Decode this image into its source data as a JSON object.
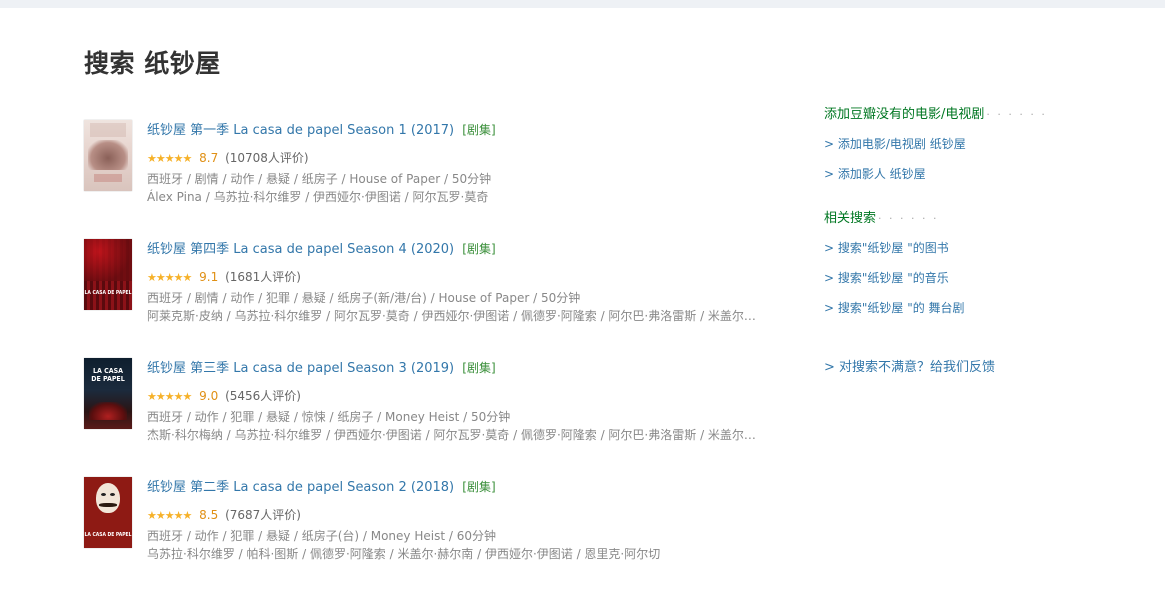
{
  "page": {
    "title": "搜索 纸钞屋"
  },
  "results": [
    {
      "title": "纸钞屋 第一季 La casa de papel Season 1 (2017)",
      "tag": "[剧集]",
      "stars": "★★★★★",
      "score": "8.7",
      "votes": "(10708人评价)",
      "meta": "西班牙 / 剧情 / 动作 / 悬疑 / 纸房子 / House of Paper / 50分钟",
      "cast": "Álex Pina / 乌苏拉·科尔维罗 / 伊西娅尔·伊图诺 / 阿尔瓦罗·莫奇",
      "poster_text": "LA CASA DE PAPEL"
    },
    {
      "title": "纸钞屋 第四季 La casa de papel Season 4 (2020)",
      "tag": "[剧集]",
      "stars": "★★★★★",
      "score": "9.1",
      "votes": "(1681人评价)",
      "meta": "西班牙 / 剧情 / 动作 / 犯罪 / 悬疑 / 纸房子(新/港/台) / House of Paper / 50分钟",
      "cast": "阿莱克斯·皮纳 / 乌苏拉·科尔维罗 / 阿尔瓦罗·莫奇 / 伊西娅尔·伊图诺 / 佩德罗·阿隆索 / 阿尔巴·弗洛雷斯 / 米盖尔·...",
      "poster_text": "LA CASA DE PAPEL"
    },
    {
      "title": "纸钞屋 第三季 La casa de papel Season 3 (2019)",
      "tag": "[剧集]",
      "stars": "★★★★★",
      "score": "9.0",
      "votes": "(5456人评价)",
      "meta": "西班牙 / 动作 / 犯罪 / 悬疑 / 惊悚 / 纸房子 / Money Heist / 50分钟",
      "cast": "杰斯·科尔梅纳 / 乌苏拉·科尔维罗 / 伊西娅尔·伊图诺 / 阿尔瓦罗·莫奇 / 佩德罗·阿隆索 / 阿尔巴·弗洛雷斯 / 米盖尔·...",
      "poster_text": "LA CASA DE PAPEL"
    },
    {
      "title": "纸钞屋 第二季 La casa de papel Season 2 (2018)",
      "tag": "[剧集]",
      "stars": "★★★★★",
      "score": "8.5",
      "votes": "(7687人评价)",
      "meta": "西班牙 / 动作 / 犯罪 / 悬疑 / 纸房子(台) / Money Heist / 60分钟",
      "cast": "乌苏拉·科尔维罗 / 帕科·图斯 / 佩德罗·阿隆索 / 米盖尔·赫尔南 / 伊西娅尔·伊图诺 / 恩里克·阿尔切",
      "poster_text": "LA CASA DE PAPEL"
    }
  ],
  "aside": {
    "add_heading": "添加豆瓣没有的电影/电视剧",
    "dots": "· · · · · ·",
    "add_movie": "> 添加电影/电视剧 纸钞屋",
    "add_person": "> 添加影人 纸钞屋",
    "related_heading": "相关搜索",
    "related_dots": "· · · · · ·",
    "related_books": "> 搜索\"纸钞屋 \"的图书",
    "related_music": "> 搜索\"纸钞屋 \"的音乐",
    "related_drama": "> 搜索\"纸钞屋 \"的 舞台剧",
    "feedback": "> 对搜索不满意？给我们反馈"
  },
  "colors": {
    "link": "#3377aa",
    "green_heading": "#007722",
    "star": "#f6b129",
    "score": "#e09015"
  }
}
